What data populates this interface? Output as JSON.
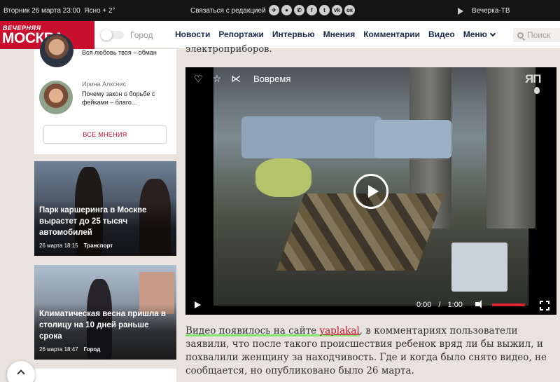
{
  "topbar": {
    "date": "Вторник 26 марта 23:00",
    "weather": "Ясно + 2°",
    "contact": "Связаться с редакцией",
    "socials": [
      "telegram-icon",
      "ok-icon",
      "whatsapp-icon",
      "facebook-icon",
      "twitter-icon",
      "vk-icon",
      "odnoklassniki-icon"
    ],
    "tv_label": "Вечерка-ТВ"
  },
  "header": {
    "logo_top": "ВЕЧЕРНЯЯ",
    "logo_main": "МОСКВА",
    "city_label": "Город",
    "menu": [
      "Новости",
      "Репортажи",
      "Интервью",
      "Мнения",
      "Комментарии",
      "Видео"
    ],
    "more_label": "Меню",
    "search_placeholder": "Поиск"
  },
  "opinions": {
    "first_title": "Вся любовь твоя – обман",
    "second_author": "Ирина Алкснис",
    "second_title": "Почему закон о борьбе с фейками – благо...",
    "all_button": "ВСЕ МНЕНИЯ"
  },
  "cards": [
    {
      "title": "Парк каршеринга в Москве вырастет до 25 тысяч автомобилей",
      "date": "26 марта 18:15",
      "tag": "Транспорт"
    },
    {
      "title": "Климатическая весна пришла в столицу на 10 дней раньше срока",
      "date": "26 марта 18:47",
      "tag": "Город"
    }
  ],
  "article": {
    "top_fragment": "электроприборов.",
    "video": {
      "title": "Вовремя",
      "logo": "ЯП",
      "current_time": "0:00",
      "separator": "/",
      "duration": "1:00"
    },
    "body_lead": "Видео появилось на сайте ",
    "body_link": "yaplakal",
    "body_rest": ", в комментариях пользователи заявили, что после такого происшествия ребенок вряд ли бы выжил, и похвалили женщину за находчивость. Где и когда было снято видео, не сообщается, но опубликовано было 26 марта."
  }
}
